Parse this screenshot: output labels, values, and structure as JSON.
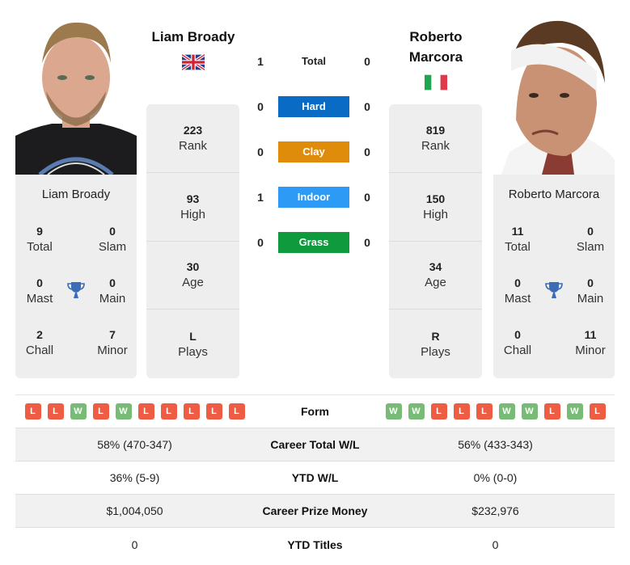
{
  "players": {
    "left": {
      "name": "Liam Broady",
      "country_flag": "uk-flag",
      "photo": "player-photo",
      "stats": [
        {
          "value": "223",
          "label": "Rank"
        },
        {
          "value": "93",
          "label": "High"
        },
        {
          "value": "30",
          "label": "Age"
        },
        {
          "value": "L",
          "label": "Plays"
        }
      ],
      "titles": {
        "total": {
          "value": "9",
          "label": "Total"
        },
        "slam": {
          "value": "0",
          "label": "Slam"
        },
        "mast": {
          "value": "0",
          "label": "Mast"
        },
        "main": {
          "value": "0",
          "label": "Main"
        },
        "chall": {
          "value": "2",
          "label": "Chall"
        },
        "minor": {
          "value": "7",
          "label": "Minor"
        }
      },
      "form": [
        "L",
        "L",
        "W",
        "L",
        "W",
        "L",
        "L",
        "L",
        "L",
        "L"
      ]
    },
    "right": {
      "name": "Roberto Marcora",
      "name_line1": "Roberto",
      "name_line2": "Marcora",
      "country_flag": "italy-flag",
      "photo": "player-photo",
      "stats": [
        {
          "value": "819",
          "label": "Rank"
        },
        {
          "value": "150",
          "label": "High"
        },
        {
          "value": "34",
          "label": "Age"
        },
        {
          "value": "R",
          "label": "Plays"
        }
      ],
      "titles": {
        "total": {
          "value": "11",
          "label": "Total"
        },
        "slam": {
          "value": "0",
          "label": "Slam"
        },
        "mast": {
          "value": "0",
          "label": "Mast"
        },
        "main": {
          "value": "0",
          "label": "Main"
        },
        "chall": {
          "value": "0",
          "label": "Chall"
        },
        "minor": {
          "value": "11",
          "label": "Minor"
        }
      },
      "form": [
        "W",
        "W",
        "L",
        "L",
        "L",
        "W",
        "W",
        "L",
        "W",
        "L"
      ]
    }
  },
  "head_to_head": [
    {
      "label": "Total",
      "left": "1",
      "right": "0",
      "color": ""
    },
    {
      "label": "Hard",
      "left": "0",
      "right": "0",
      "color": "#0a6bc4"
    },
    {
      "label": "Clay",
      "left": "0",
      "right": "0",
      "color": "#e08c0b"
    },
    {
      "label": "Indoor",
      "left": "1",
      "right": "0",
      "color": "#2d9af5"
    },
    {
      "label": "Grass",
      "left": "0",
      "right": "0",
      "color": "#0f9b3d"
    }
  ],
  "comparison": {
    "form_label": "Form",
    "rows": [
      {
        "label": "Career Total W/L",
        "left": "58% (470-347)",
        "right": "56% (433-343)"
      },
      {
        "label": "YTD W/L",
        "left": "36% (5-9)",
        "right": "0% (0-0)"
      },
      {
        "label": "Career Prize Money",
        "left": "$1,004,050",
        "right": "$232,976"
      },
      {
        "label": "YTD Titles",
        "left": "0",
        "right": "0"
      }
    ]
  },
  "colors": {
    "win": "#77bb77",
    "loss": "#ee5c44",
    "trophy": "#3a6db5",
    "card_bg": "#eeeeee"
  }
}
